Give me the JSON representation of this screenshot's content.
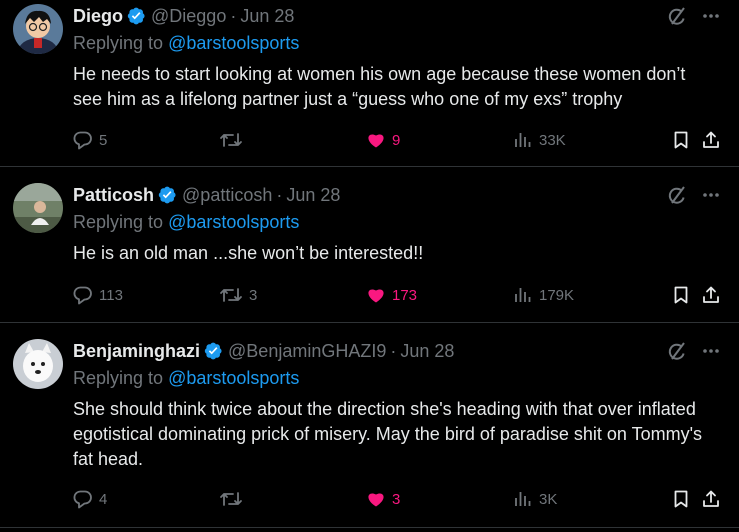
{
  "tweets": [
    {
      "name": "Diego",
      "handle": "@Dieggo",
      "date": "Jun 28",
      "replying_prefix": "Replying to ",
      "replying_to": "@barstoolsports",
      "text": "He needs to start looking at women his own age because these women don’t see him as a lifelong partner just a “guess who one of my exs” trophy",
      "replies": "5",
      "retweets": "",
      "likes": "9",
      "views": "33K"
    },
    {
      "name": "Patticosh",
      "handle": "@patticosh",
      "date": "Jun 28",
      "replying_prefix": "Replying to ",
      "replying_to": "@barstoolsports",
      "text": "He is an old man ...she won’t be interested!!",
      "replies": "113",
      "retweets": "3",
      "likes": "173",
      "views": "179K"
    },
    {
      "name": "Benjaminghazi",
      "handle": "@BenjaminGHAZI9",
      "date": "Jun 28",
      "replying_prefix": "Replying to ",
      "replying_to": "@barstoolsports",
      "text": "She should think twice about the direction she's heading with that over inflated egotistical dominating prick of misery. May the bird of paradise shit on Tommy's fat head.",
      "replies": "4",
      "retweets": "",
      "likes": "3",
      "views": "3K"
    }
  ],
  "separator": "·",
  "colors": {
    "background": "#000000",
    "text": "#e7e9ea",
    "muted": "#71767b",
    "link": "#1d9bf0",
    "like": "#f91880",
    "border": "#2f3336"
  },
  "icons": [
    "verified-badge-icon",
    "grok-icon",
    "more-icon",
    "reply-icon",
    "retweet-icon",
    "like-icon",
    "views-icon",
    "bookmark-icon",
    "share-icon"
  ]
}
